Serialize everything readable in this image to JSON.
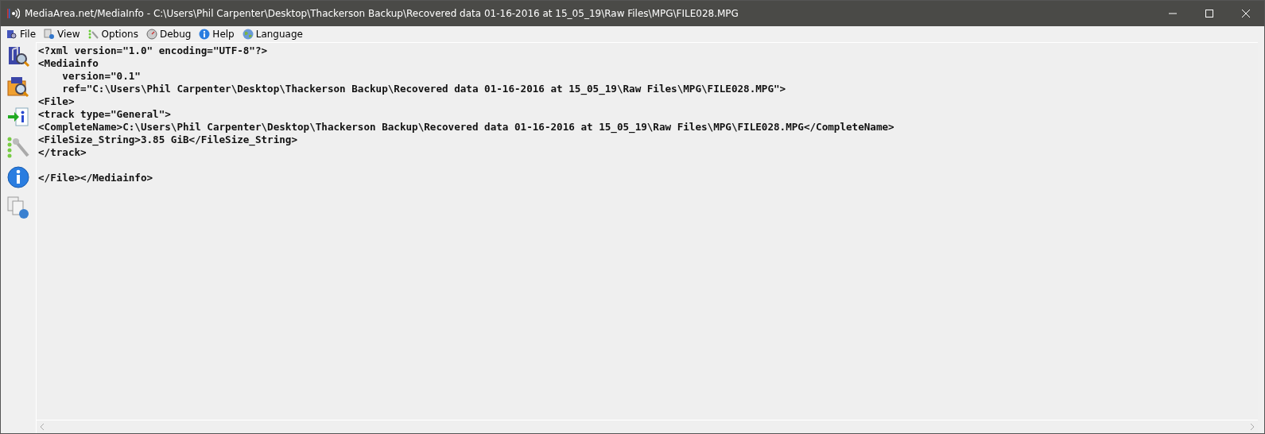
{
  "window": {
    "title": "MediaArea.net/MediaInfo - C:\\Users\\Phil Carpenter\\Desktop\\Thackerson Backup\\Recovered data 01-16-2016 at 15_05_19\\Raw Files\\MPG\\FILE028.MPG"
  },
  "menu": [
    "File",
    "View",
    "Options",
    "Debug",
    "Help",
    "Language"
  ],
  "text_view": {
    "blocks": [
      [
        "<?xml version=\"1.0\" encoding=\"UTF-8\"?>",
        "<Mediainfo",
        "    version=\"0.1\"",
        "    ref=\"C:\\Users\\Phil Carpenter\\Desktop\\Thackerson Backup\\Recovered data 01-16-2016 at 15_05_19\\Raw Files\\MPG\\FILE028.MPG\">",
        "<File>",
        "<track type=\"General\">",
        "<CompleteName>C:\\Users\\Phil Carpenter\\Desktop\\Thackerson Backup\\Recovered data 01-16-2016 at 15_05_19\\Raw Files\\MPG\\FILE028.MPG</CompleteName>",
        "<FileSize_String>3.85 GiB</FileSize_String>",
        "</track>"
      ],
      [
        "</File></Mediainfo>"
      ]
    ]
  }
}
